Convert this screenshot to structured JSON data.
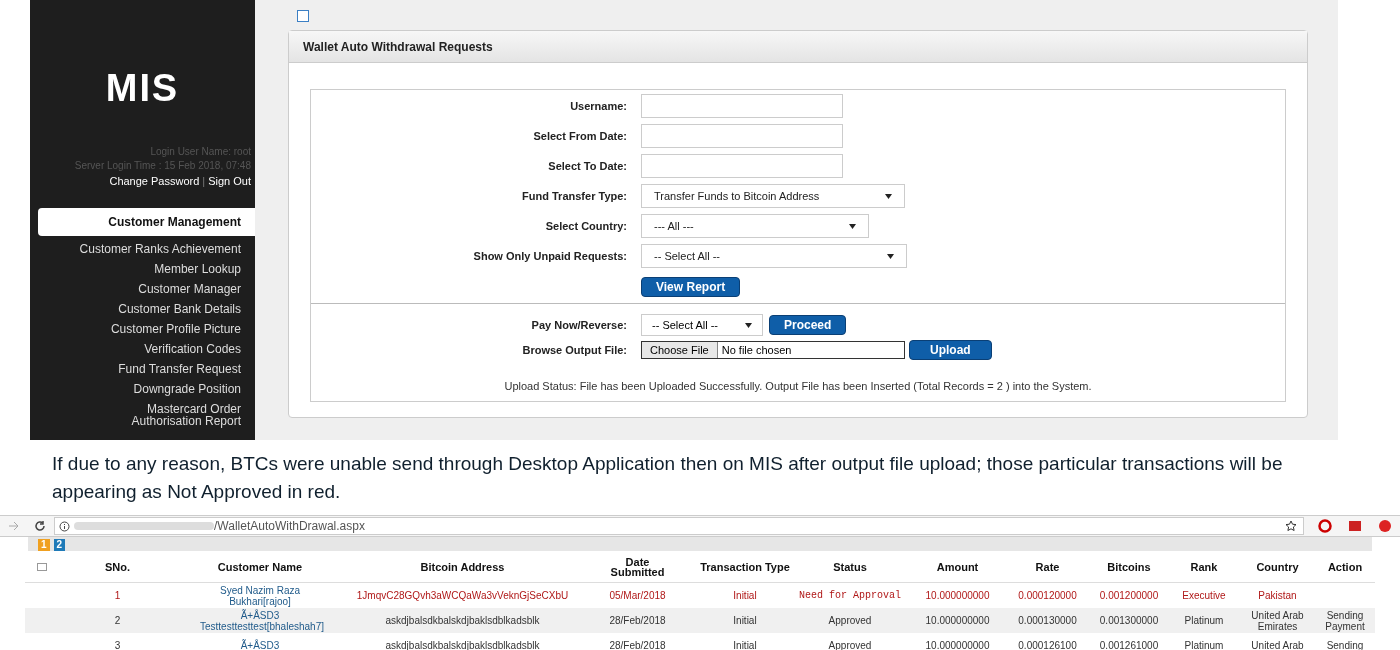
{
  "sidebar": {
    "logo": "MIS",
    "login_user": "Login User Name: root",
    "login_time": "Server Login Time : 15 Feb 2018, 07:48",
    "links": [
      {
        "label": "Change Password"
      },
      {
        "label": "Sign Out"
      }
    ],
    "separator": "|",
    "items": [
      {
        "label": "Customer Management",
        "selected": true
      },
      {
        "label": "Customer Ranks Achievement",
        "selected": false
      },
      {
        "label": "Member Lookup",
        "selected": false
      },
      {
        "label": "Customer Manager",
        "selected": false
      },
      {
        "label": "Customer Bank Details",
        "selected": false
      },
      {
        "label": "Customer Profile Picture",
        "selected": false
      },
      {
        "label": "Verification Codes",
        "selected": false
      },
      {
        "label": "Fund Transfer Request",
        "selected": false
      },
      {
        "label": "Downgrade Position",
        "selected": false
      },
      {
        "label": "Mastercard Order Authorisation Report",
        "selected": false
      }
    ]
  },
  "panel": {
    "title": "Wallet Auto Withdrawal Requests",
    "fields": [
      {
        "kind": "input",
        "label": "Username:"
      },
      {
        "kind": "input",
        "label": "Select From Date:"
      },
      {
        "kind": "input",
        "label": "Select To Date:"
      },
      {
        "kind": "select",
        "label": "Fund Transfer Type:",
        "value": "Transfer Funds to Bitcoin Address"
      },
      {
        "kind": "select",
        "label": "Select Country:",
        "value": "--- All ---"
      },
      {
        "kind": "select",
        "label": "Show Only Unpaid Requests:",
        "value": "-- Select All --"
      }
    ],
    "view_button": "View Report",
    "pay_label": "Pay Now/Reverse:",
    "pay_value": "-- Select All --",
    "proceed_button": "Proceed",
    "file_label": "Browse Output File:",
    "choose_button": "Choose File",
    "file_status": "No file chosen",
    "upload_button": "Upload",
    "upload_status": "Upload Status: File has been Uploaded Successfully. Output File has been Inserted (Total Records = 2 ) into the System."
  },
  "caption": "If due to any reason, BTCs were unable send through Desktop Application then on MIS after output file upload; those particular transactions will be appearing as Not Approved in red.",
  "top_checkbox": {
    "checked": false
  },
  "browser": {
    "url": "/WalletAutoWithDrawal.aspx"
  },
  "pages": [
    {
      "label": "1",
      "selected": true
    },
    {
      "label": "2",
      "selected": false
    }
  ],
  "table": {
    "select_all_checked": false,
    "columns": [
      "SNo.",
      "Customer Name",
      "Bitcoin Address",
      "Date Submitted",
      "Transaction Type",
      "Status",
      "Amount",
      "Rate",
      "Bitcoins",
      "Rank",
      "Country",
      "Action"
    ],
    "rows": [
      {
        "flagged": true,
        "cells": [
          "1",
          "Syed Nazim Raza Bukhari[rajoo]",
          "1JmqvC28GQvh3aWCQaWa3vVeknGjSeCXbU",
          "05/Mar/2018",
          "Initial",
          "Need for Approval",
          "10.000000000",
          "0.000120000",
          "0.001200000",
          "Executive",
          "Pakistan",
          ""
        ]
      },
      {
        "flagged": false,
        "cells": [
          "2",
          "Ã+ÅSD3 Testtesttesttest[bhaleshah7]",
          "askdjbalsdkbalskdjbaklsdblkadsblk",
          "28/Feb/2018",
          "Initial",
          "Approved",
          "10.000000000",
          "0.000130000",
          "0.001300000",
          "Platinum",
          "United Arab Emirates",
          "Sending Payment"
        ]
      },
      {
        "flagged": false,
        "cells": [
          "3",
          "Ã+ÅSD3",
          "askdjbalsdkbalskdjbaklsdblkadsblk",
          "28/Feb/2018",
          "Initial",
          "Approved",
          "10.000000000",
          "0.000126100",
          "0.001261000",
          "Platinum",
          "United Arab",
          "Sending"
        ]
      }
    ]
  }
}
